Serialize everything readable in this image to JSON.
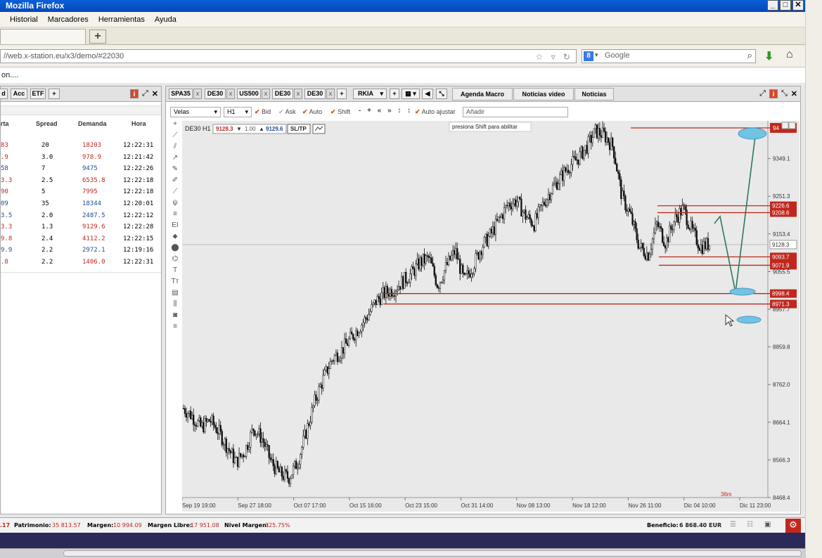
{
  "browser": {
    "title": "Mozilla Firefox",
    "menu": [
      "Historial",
      "Marcadores",
      "Herramientas",
      "Ayuda"
    ],
    "url": "//web.x-station.eu/x3/demo/#22030",
    "search_placeholder": "Google",
    "status_text": "on...."
  },
  "left_panel": {
    "tabs": [
      "d",
      "Acc",
      "ETF",
      "+"
    ],
    "headers": [
      "rta",
      "Spread",
      "Demanda",
      "Hora"
    ],
    "rows": [
      {
        "bid": "83",
        "spread": "20",
        "ask": "18203",
        "time": "12:22:31",
        "color": "red"
      },
      {
        "bid": ".9",
        "spread": "3.0",
        "ask": "978.9",
        "time": "12:21:42",
        "color": "red"
      },
      {
        "bid": "58",
        "spread": "7",
        "ask": "9475",
        "time": "12:22:26",
        "color": "blue"
      },
      {
        "bid": "3.3",
        "spread": "2.5",
        "ask": "6535.8",
        "time": "12:22:18",
        "color": "red"
      },
      {
        "bid": "90",
        "spread": "5",
        "ask": "7995",
        "time": "12:22:18",
        "color": "red"
      },
      {
        "bid": "09",
        "spread": "35",
        "ask": "18344",
        "time": "12:20:01",
        "color": "blue"
      },
      {
        "bid": "3.5",
        "spread": "2.0",
        "ask": "2487.5",
        "time": "12:22:12",
        "color": "blue"
      },
      {
        "bid": "3.3",
        "spread": "1.3",
        "ask": "9129.6",
        "time": "12:22:28",
        "color": "red"
      },
      {
        "bid": "9.8",
        "spread": "2.4",
        "ask": "4112.2",
        "time": "12:22:15",
        "color": "red"
      },
      {
        "bid": "9.9",
        "spread": "2.2",
        "ask": "2972.1",
        "time": "12:19:16",
        "color": "blue"
      },
      {
        "bid": ".8",
        "spread": "2.2",
        "ask": "1406.0",
        "time": "12:22:31",
        "color": "red"
      }
    ]
  },
  "chart_panel": {
    "instrument_tabs": [
      "SPA35",
      "DE30",
      "US500",
      "DE30",
      "DE30"
    ],
    "symbol_select": "RKIA",
    "news_tabs": [
      "Agenda Macro",
      "Noticias video",
      "Noticias"
    ],
    "chart_type": "Velas",
    "timeframe": "H1",
    "toolbar_labels": [
      "Bid",
      "Ask",
      "Auto",
      "Shift",
      "Auto ajustar"
    ],
    "add_placeholder": "Añadir",
    "symbol_label": "DE30 H1",
    "bid_price": "9128.3",
    "volume": "1.00",
    "ask_price": "9129.6",
    "sltp_label": "SL/TP",
    "hint": "presiona Shift para abilitar"
  },
  "chart_data": {
    "type": "candlestick",
    "y_ticks": [
      "9349.1",
      "9251.3",
      "9153.4",
      "9055.5",
      "8957.7",
      "8859.8",
      "8762.0",
      "8664.1",
      "8566.3",
      "8468.4"
    ],
    "y_range": [
      8468.4,
      9447.0
    ],
    "x_ticks": [
      "Sep 19 19:00",
      "Sep 27 18:00",
      "Oct 07 17:00",
      "Oct 15 16:00",
      "Oct 23 15:00",
      "Oct 31 14:00",
      "Nov 08 13:00",
      "Nov 18 12:00",
      "Nov 26 11:00",
      "Dic 04 10:00",
      "Dic 11 23:00"
    ],
    "current_price": "9128.3",
    "price_tags": [
      "9226.6",
      "9208.6",
      "9093.7",
      "9071.9",
      "8998.4",
      "8971.3"
    ],
    "top_tag": "94",
    "timer": "36m",
    "close_path": [
      8700,
      8680,
      8650,
      8670,
      8640,
      8600,
      8560,
      8590,
      8650,
      8620,
      8560,
      8530,
      8520,
      8560,
      8640,
      8720,
      8780,
      8830,
      8850,
      8880,
      8910,
      8940,
      8980,
      9000,
      9010,
      9030,
      9050,
      9080,
      9090,
      9020,
      9070,
      9110,
      9030,
      9070,
      9120,
      9150,
      9190,
      9230,
      9240,
      9200,
      9180,
      9230,
      9270,
      9300,
      9330,
      9350,
      9380,
      9420,
      9410,
      9380,
      9250,
      9200,
      9120,
      9100,
      9180,
      9130,
      9190,
      9220,
      9160,
      9120,
      9128
    ]
  },
  "footer": {
    "balance_partial": ".17",
    "equity_label": "Patrimonio:",
    "equity": "35 813.57",
    "margin_label": "Margen:",
    "margin": "10 994.09",
    "free_margin_label": "Margen Libre:",
    "free_margin": "17 951.08",
    "margin_level_label": "Nivel Margen:",
    "margin_level": "325.75%",
    "profit_label": "Beneficio:",
    "profit": "6 868.40 EUR"
  }
}
